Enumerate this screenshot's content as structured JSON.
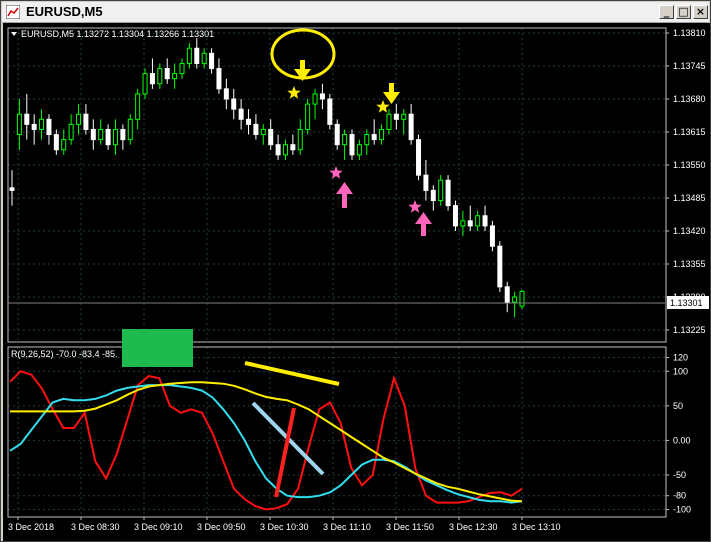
{
  "window": {
    "title": "EURUSD,M5",
    "buttons": [
      "_",
      "□",
      "×"
    ]
  },
  "symbol_line": "EURUSD,M5  1.13272 1.13304 1.13266 1.13301",
  "indicator_line": "R(9,26,52) -70.0 -83.4 -85.",
  "current_price": "1.13301",
  "colors": {
    "bull_candle": "#00ff00",
    "bear_candle": "#ffffff",
    "grid": "#1f3f3f",
    "red_line": "#ff1010",
    "cyan_line": "#33ddee",
    "yellow_line": "#ffee00",
    "annotation_pink": "#ff66bb",
    "annotation_green": "#1fba4f"
  },
  "chart_data": [
    {
      "type": "candlestick",
      "price_axis_ticks": [
        "1.13810",
        "1.13745",
        "1.13680",
        "1.13615",
        "1.13550",
        "1.13485",
        "1.13420",
        "1.13355",
        "1.13290",
        "1.13225"
      ],
      "ylim": [
        1.13225,
        1.1381
      ],
      "time_axis_ticks": [
        "3 Dec 2018",
        "3 Dec 08:30",
        "3 Dec 09:10",
        "3 Dec 09:50",
        "3 Dec 10:30",
        "3 Dec 11:10",
        "3 Dec 11:50",
        "3 Dec 12:30",
        "3 Dec 13:10"
      ],
      "ohlc": [
        [
          1.13505,
          1.1354,
          1.1347,
          1.135
        ],
        [
          1.1361,
          1.1368,
          1.1358,
          1.1365
        ],
        [
          1.1365,
          1.1369,
          1.136,
          1.1363
        ],
        [
          1.1363,
          1.1365,
          1.1359,
          1.1362
        ],
        [
          1.1362,
          1.1366,
          1.136,
          1.1364
        ],
        [
          1.1364,
          1.1365,
          1.1359,
          1.1361
        ],
        [
          1.1361,
          1.1362,
          1.1357,
          1.1358
        ],
        [
          1.1358,
          1.1362,
          1.1357,
          1.136
        ],
        [
          1.136,
          1.1365,
          1.1359,
          1.1363
        ],
        [
          1.1363,
          1.1367,
          1.1361,
          1.1365
        ],
        [
          1.1365,
          1.1367,
          1.1361,
          1.1362
        ],
        [
          1.1362,
          1.1364,
          1.1358,
          1.136
        ],
        [
          1.136,
          1.1364,
          1.1359,
          1.1362
        ],
        [
          1.1362,
          1.1363,
          1.1358,
          1.1359
        ],
        [
          1.1359,
          1.1364,
          1.1357,
          1.1362
        ],
        [
          1.1362,
          1.1363,
          1.1358,
          1.136
        ],
        [
          1.136,
          1.1365,
          1.1359,
          1.1364
        ],
        [
          1.1364,
          1.137,
          1.1362,
          1.1369
        ],
        [
          1.1369,
          1.1374,
          1.1368,
          1.1373
        ],
        [
          1.1373,
          1.1376,
          1.137,
          1.1371
        ],
        [
          1.1371,
          1.1375,
          1.137,
          1.1374
        ],
        [
          1.1374,
          1.1376,
          1.1371,
          1.1372
        ],
        [
          1.1372,
          1.1375,
          1.137,
          1.1373
        ],
        [
          1.1373,
          1.1376,
          1.1372,
          1.1375
        ],
        [
          1.1375,
          1.1379,
          1.1374,
          1.1378
        ],
        [
          1.1378,
          1.138,
          1.1374,
          1.1375
        ],
        [
          1.1375,
          1.1378,
          1.1374,
          1.1377
        ],
        [
          1.1377,
          1.1378,
          1.1373,
          1.1374
        ],
        [
          1.1374,
          1.1376,
          1.1369,
          1.137
        ],
        [
          1.137,
          1.1372,
          1.1366,
          1.1368
        ],
        [
          1.1368,
          1.137,
          1.1364,
          1.1366
        ],
        [
          1.1366,
          1.1368,
          1.1362,
          1.1364
        ],
        [
          1.1364,
          1.1366,
          1.1361,
          1.1363
        ],
        [
          1.1363,
          1.1365,
          1.136,
          1.1361
        ],
        [
          1.1361,
          1.1363,
          1.1359,
          1.1362
        ],
        [
          1.1362,
          1.1364,
          1.1358,
          1.1359
        ],
        [
          1.1359,
          1.1361,
          1.1356,
          1.1357
        ],
        [
          1.1357,
          1.136,
          1.1356,
          1.1359
        ],
        [
          1.1359,
          1.1361,
          1.1357,
          1.1358
        ],
        [
          1.1358,
          1.1364,
          1.1357,
          1.1362
        ],
        [
          1.1362,
          1.1368,
          1.1361,
          1.1367
        ],
        [
          1.1367,
          1.137,
          1.1364,
          1.1369
        ],
        [
          1.1369,
          1.1371,
          1.1366,
          1.1368
        ],
        [
          1.1368,
          1.1369,
          1.1362,
          1.1363
        ],
        [
          1.1363,
          1.1364,
          1.1358,
          1.1359
        ],
        [
          1.1359,
          1.1362,
          1.1356,
          1.1361
        ],
        [
          1.1361,
          1.1362,
          1.1356,
          1.1357
        ],
        [
          1.1357,
          1.136,
          1.1356,
          1.1359
        ],
        [
          1.1359,
          1.1362,
          1.1357,
          1.1361
        ],
        [
          1.1361,
          1.1364,
          1.1359,
          1.136
        ],
        [
          1.136,
          1.1363,
          1.1359,
          1.1362
        ],
        [
          1.1362,
          1.1366,
          1.1361,
          1.1365
        ],
        [
          1.1365,
          1.1367,
          1.1362,
          1.1364
        ],
        [
          1.1364,
          1.1366,
          1.1361,
          1.1365
        ],
        [
          1.1365,
          1.1367,
          1.1359,
          1.136
        ],
        [
          1.136,
          1.1361,
          1.1352,
          1.1353
        ],
        [
          1.1353,
          1.1356,
          1.1348,
          1.135
        ],
        [
          1.135,
          1.1351,
          1.1346,
          1.1348
        ],
        [
          1.1348,
          1.1353,
          1.1347,
          1.1352
        ],
        [
          1.1352,
          1.1353,
          1.1346,
          1.1347
        ],
        [
          1.1347,
          1.1348,
          1.1342,
          1.1343
        ],
        [
          1.1343,
          1.1346,
          1.1341,
          1.1344
        ],
        [
          1.1344,
          1.1347,
          1.1342,
          1.1343
        ],
        [
          1.1343,
          1.1346,
          1.1342,
          1.1345
        ],
        [
          1.1345,
          1.1347,
          1.1342,
          1.1343
        ],
        [
          1.1343,
          1.1344,
          1.1338,
          1.1339
        ],
        [
          1.1339,
          1.134,
          1.133,
          1.1331
        ],
        [
          1.1331,
          1.1332,
          1.1326,
          1.1328
        ],
        [
          1.1328,
          1.133,
          1.1325,
          1.1329
        ],
        [
          1.13272,
          1.13304,
          1.13266,
          1.13301
        ]
      ]
    },
    {
      "type": "line",
      "title": "R(9,26,52) -70.0 -83.4 -85.",
      "y_axis_ticks": [
        "120",
        "100",
        "50",
        "0.00",
        "-50",
        "-80",
        "-100"
      ],
      "ylim": [
        -105,
        125
      ],
      "series": [
        {
          "color": "#ff1010",
          "values": [
            85,
            100,
            95,
            75,
            45,
            18,
            18,
            40,
            -30,
            -55,
            -20,
            30,
            80,
            93,
            90,
            50,
            40,
            45,
            40,
            10,
            -30,
            -70,
            -85,
            -95,
            -100,
            -98,
            -92,
            -70,
            -10,
            45,
            55,
            25,
            -40,
            -65,
            -50,
            30,
            90,
            50,
            -40,
            -80,
            -90,
            -90,
            -90,
            -88,
            -82,
            -76,
            -75,
            -80,
            -70
          ]
        },
        {
          "color": "#33ddee",
          "values": [
            -15,
            -5,
            15,
            35,
            55,
            60,
            58,
            58,
            60,
            65,
            72,
            76,
            78,
            80,
            80,
            80,
            78,
            76,
            72,
            62,
            45,
            25,
            0,
            -30,
            -55,
            -70,
            -80,
            -82,
            -82,
            -80,
            -75,
            -65,
            -50,
            -35,
            -28,
            -28,
            -30,
            -38,
            -48,
            -58,
            -65,
            -72,
            -78,
            -82,
            -86,
            -88,
            -88,
            -90,
            -88
          ]
        },
        {
          "color": "#ffee00",
          "values": [
            42,
            42,
            42,
            42,
            42,
            42,
            42,
            43,
            46,
            52,
            58,
            66,
            73,
            78,
            80,
            82,
            83,
            84,
            84,
            83,
            82,
            79,
            74,
            68,
            63,
            60,
            58,
            52,
            45,
            35,
            25,
            15,
            5,
            -5,
            -15,
            -25,
            -32,
            -40,
            -48,
            -55,
            -62,
            -67,
            -70,
            -74,
            -78,
            -81,
            -84,
            -87,
            -88
          ]
        }
      ]
    }
  ]
}
